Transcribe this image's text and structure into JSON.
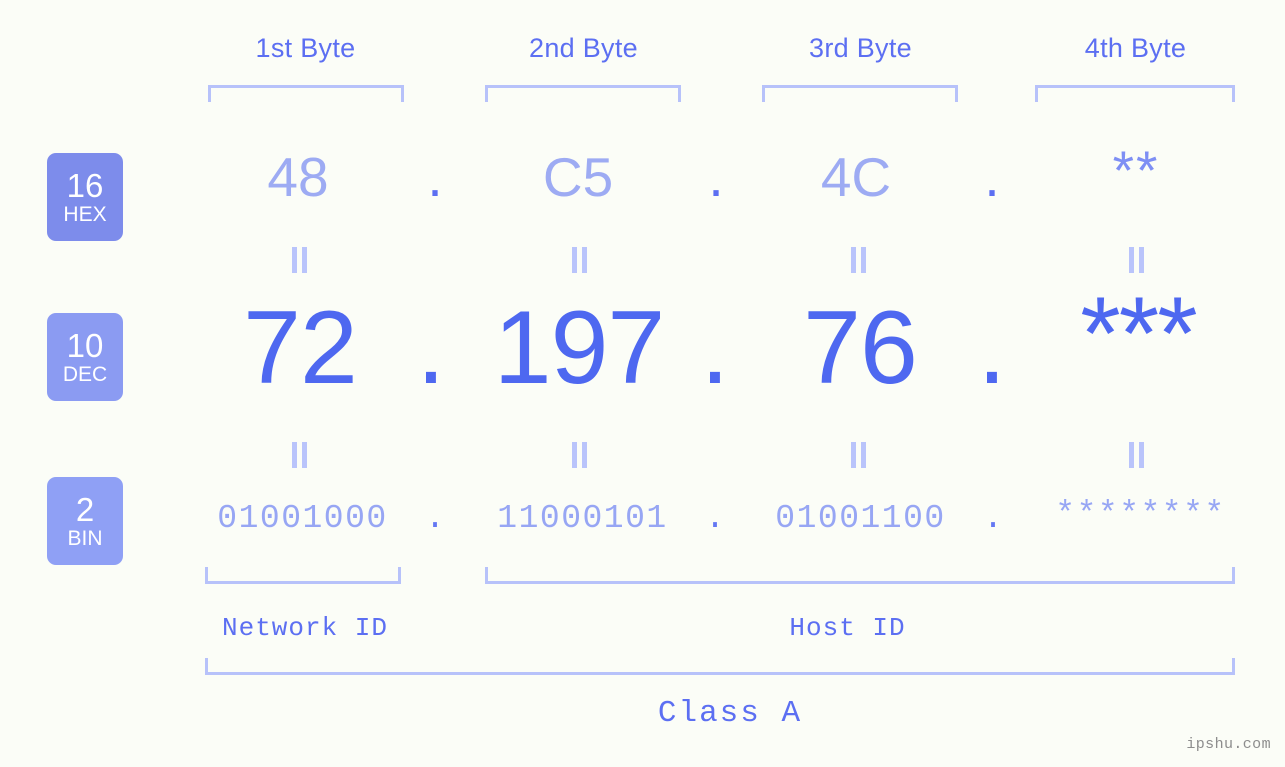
{
  "page": {
    "background_color": "#fbfdf7",
    "watermark": "ipshu.com"
  },
  "colors": {
    "header_text": "#5c6ff2",
    "bracket": "#b7c2fa",
    "hex_value": "#9dabf3",
    "dec_value": "#4e68f0",
    "bin_value": "#97a6f4",
    "badge_hex": "#7d8ceb",
    "badge_dec": "#8b9bf2",
    "badge_bin": "#8fa0f5",
    "separator": "#b9c4fb",
    "watermark": "#8d8d8d"
  },
  "byte_headers": [
    {
      "label": "1st Byte"
    },
    {
      "label": "2nd Byte"
    },
    {
      "label": "3rd Byte"
    },
    {
      "label": "4th Byte"
    }
  ],
  "bases": [
    {
      "number": "16",
      "name": "HEX"
    },
    {
      "number": "10",
      "name": "DEC"
    },
    {
      "number": "2",
      "name": "BIN"
    }
  ],
  "rows": {
    "hex": {
      "values": [
        "48",
        "C5",
        "4C",
        "**"
      ],
      "separator": "."
    },
    "dec": {
      "values": [
        "72",
        "197",
        "76",
        "***"
      ],
      "separator": "."
    },
    "bin": {
      "values": [
        "01001000",
        "11000101",
        "01001100",
        "********"
      ],
      "separator": "."
    }
  },
  "separators": {
    "equals": "="
  },
  "segments": {
    "network_id": "Network ID",
    "host_id": "Host ID",
    "class": "Class A"
  }
}
